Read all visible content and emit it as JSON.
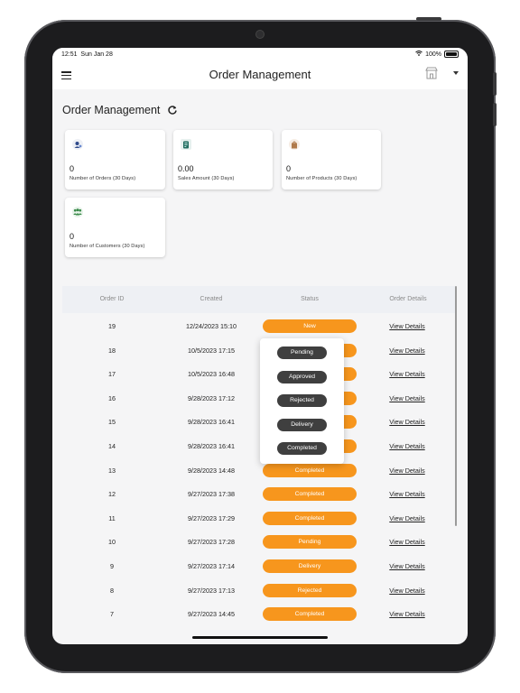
{
  "status_bar": {
    "time": "12:51",
    "date": "Sun Jan 28",
    "battery": "100%",
    "wifi_icon": "wifi-icon"
  },
  "app_bar": {
    "title": "Order Management",
    "menu_icon": "hamburger-menu-icon",
    "store_icon": "store-icon",
    "dropdown_icon": "caret-down-icon"
  },
  "section": {
    "title": "Order Management",
    "refresh_icon": "refresh-icon"
  },
  "stats": [
    {
      "value": "0",
      "label": "Number of Orders (30 Days)",
      "icon": "orders-icon",
      "icon_color": "#2f4a8a"
    },
    {
      "value": "0.00",
      "label": "Sales Amount (30 Days)",
      "icon": "sales-icon",
      "icon_color": "#1f6b5e"
    },
    {
      "value": "0",
      "label": "Number of Products (30 Days)",
      "icon": "products-icon",
      "icon_color": "#b07a4a"
    },
    {
      "value": "0",
      "label": "Number of Customers (30 Days)",
      "icon": "customers-icon",
      "icon_color": "#3a8a4a"
    }
  ],
  "table": {
    "headers": {
      "id": "Order ID",
      "created": "Created",
      "status": "Status",
      "details": "Order Details"
    },
    "rows": [
      {
        "id": "19",
        "created": "12/24/2023 15:10",
        "status": "New",
        "details": "View Details"
      },
      {
        "id": "18",
        "created": "10/5/2023 17:15",
        "status": "",
        "details": "View Details"
      },
      {
        "id": "17",
        "created": "10/5/2023 16:48",
        "status": "",
        "details": "View Details"
      },
      {
        "id": "16",
        "created": "9/28/2023 17:12",
        "status": "",
        "details": "View Details"
      },
      {
        "id": "15",
        "created": "9/28/2023 16:41",
        "status": "",
        "details": "View Details"
      },
      {
        "id": "14",
        "created": "9/28/2023 16:41",
        "status": "",
        "details": "View Details"
      },
      {
        "id": "13",
        "created": "9/28/2023 14:48",
        "status": "Completed",
        "details": "View Details"
      },
      {
        "id": "12",
        "created": "9/27/2023 17:38",
        "status": "Completed",
        "details": "View Details"
      },
      {
        "id": "11",
        "created": "9/27/2023 17:29",
        "status": "Completed",
        "details": "View Details"
      },
      {
        "id": "10",
        "created": "9/27/2023 17:28",
        "status": "Pending",
        "details": "View Details"
      },
      {
        "id": "9",
        "created": "9/27/2023 17:14",
        "status": "Delivery",
        "details": "View Details"
      },
      {
        "id": "8",
        "created": "9/27/2023 17:13",
        "status": "Rejected",
        "details": "View Details"
      },
      {
        "id": "7",
        "created": "9/27/2023 14:45",
        "status": "Completed",
        "details": "View Details"
      }
    ]
  },
  "status_menu": {
    "options": [
      "Pending",
      "Approved",
      "Rejected",
      "Delivery",
      "Completed"
    ]
  },
  "colors": {
    "status_pill": "#f7961d",
    "menu_option": "#3f3f3f",
    "header_bg": "#eef0f4"
  }
}
